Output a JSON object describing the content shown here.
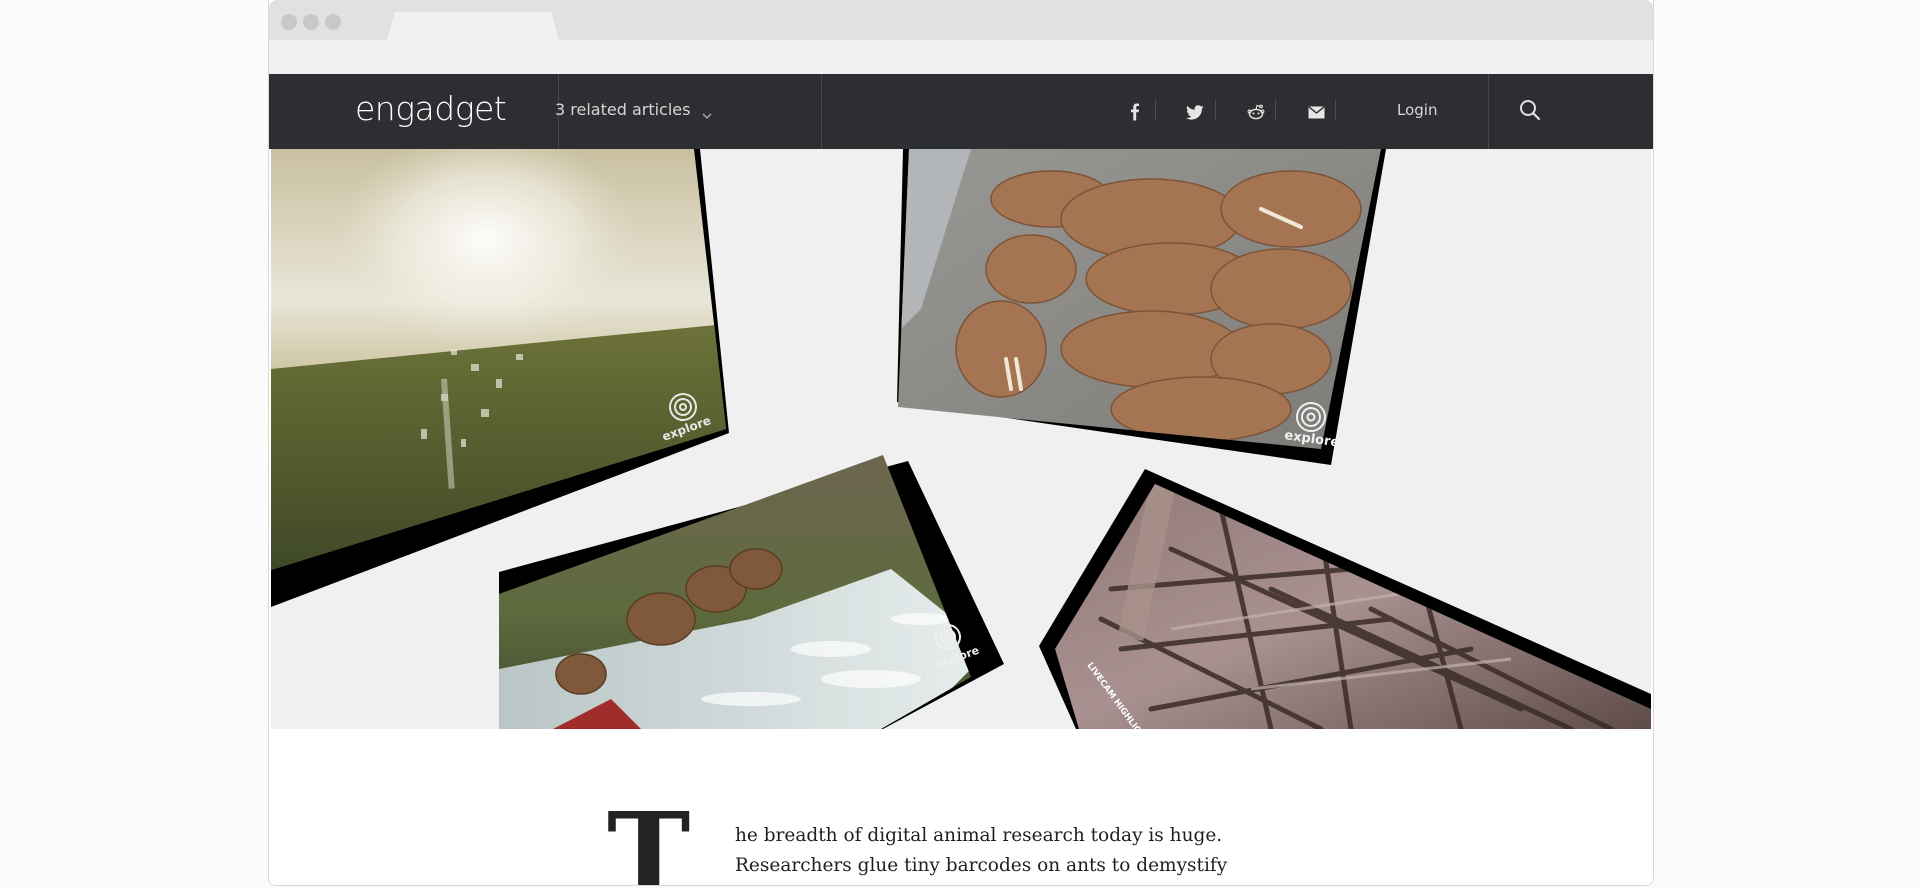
{
  "browser": {
    "window_dots": [
      "close",
      "minimize",
      "maximize"
    ]
  },
  "header": {
    "logo_text": "engadget",
    "related_articles_label": "3 related articles",
    "social_icons": [
      "facebook-icon",
      "twitter-icon",
      "reddit-icon",
      "email-icon"
    ],
    "login_label": "Login",
    "search_icon": "search-icon"
  },
  "hero": {
    "images": [
      {
        "name": "sunset-tundra-cam",
        "watermark": "explore"
      },
      {
        "name": "walrus-cam",
        "watermark": "explore"
      },
      {
        "name": "brown-bears-waterfall-cam",
        "watermark": "explore"
      },
      {
        "name": "owl-nest-cam",
        "watermark": "LIVECAM HIGHLIGHTS"
      }
    ]
  },
  "article": {
    "drop_cap": "T",
    "lines": [
      "he breadth of digital animal research today is huge.",
      "Researchers glue tiny barcodes on ants to demystify what"
    ]
  },
  "colors": {
    "navbar_bg": "#2d2e31",
    "hero_bg": "#f0f0f0"
  }
}
